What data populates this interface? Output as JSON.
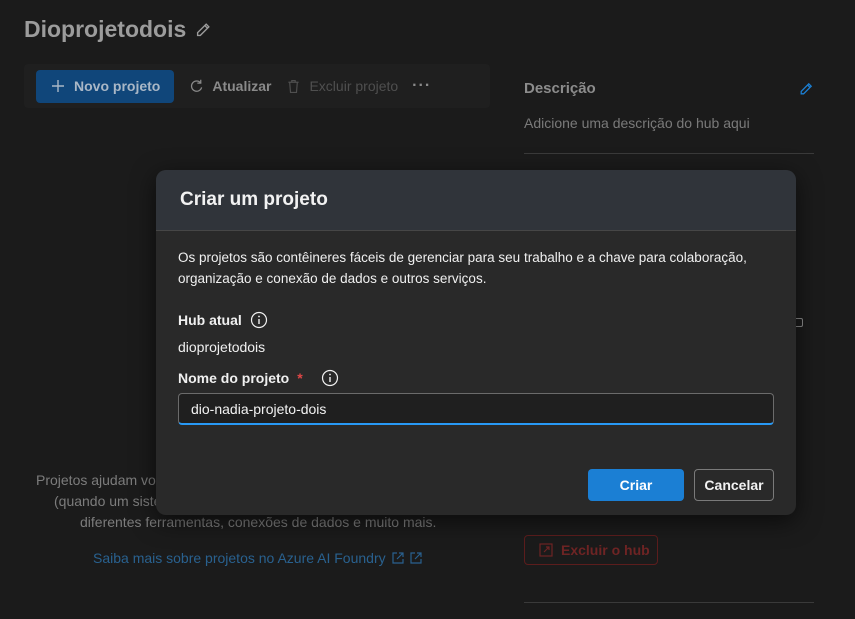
{
  "page": {
    "title": "Dioprojetodois"
  },
  "toolbar": {
    "new_project": "Novo projeto",
    "refresh": "Atualizar",
    "delete_project": "Excluir projeto",
    "more": "···"
  },
  "description": {
    "title": "Descrição",
    "text": "Adicione uma descrição do hub aqui"
  },
  "background": {
    "text": "Projetos ajudam você (quando um sistema diferentes ferramentas, conexões de dados e muito mais.",
    "line1": "Projetos ajudam voc",
    "line2": "(quando um siste",
    "line3": "diferentes ferramentas, conexões de dados e muito mais.",
    "link": "Saiba mais sobre projetos no Azure AI Foundry"
  },
  "danger": {
    "delete_hub": "Excluir o hub"
  },
  "modal": {
    "title": "Criar um projeto",
    "description": "Os projetos são contêineres fáceis de gerenciar para seu trabalho e a chave para colaboração, organização e conexão de dados e outros serviços.",
    "current_hub_label": "Hub atual",
    "current_hub_value": "dioprojetodois",
    "project_name_label": "Nome do projeto",
    "required_marker": "*",
    "project_name_value": "dio-nadia-projeto-dois",
    "create_label": "Criar",
    "cancel_label": "Cancelar"
  },
  "icons": {
    "edit": "pencil-icon",
    "plus": "plus-icon",
    "refresh": "refresh-icon",
    "trash": "trash-icon",
    "info": "info-icon",
    "external": "external-link-icon"
  },
  "colors": {
    "accent": "#1b7fd4",
    "required": "#e04646",
    "danger": "#6e2424"
  }
}
